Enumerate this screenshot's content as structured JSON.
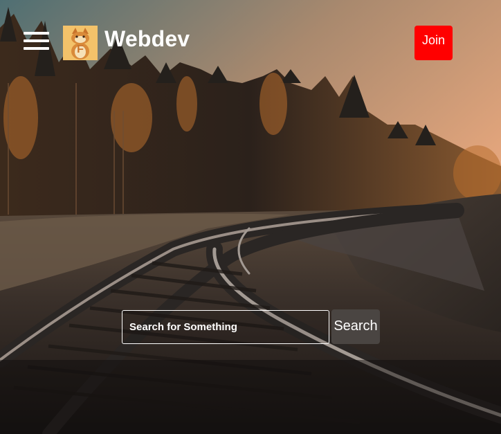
{
  "header": {
    "brand": "Webdev",
    "logo_letter": "F",
    "join_label": "Join"
  },
  "search": {
    "placeholder": "Search for Something",
    "button_label": "Search"
  },
  "colors": {
    "join": "#ff0000",
    "search_button": "#4a4542",
    "text": "#ffffff"
  },
  "icons": {
    "menu": "hamburger-menu-icon",
    "logo": "cat-mascot-logo"
  }
}
